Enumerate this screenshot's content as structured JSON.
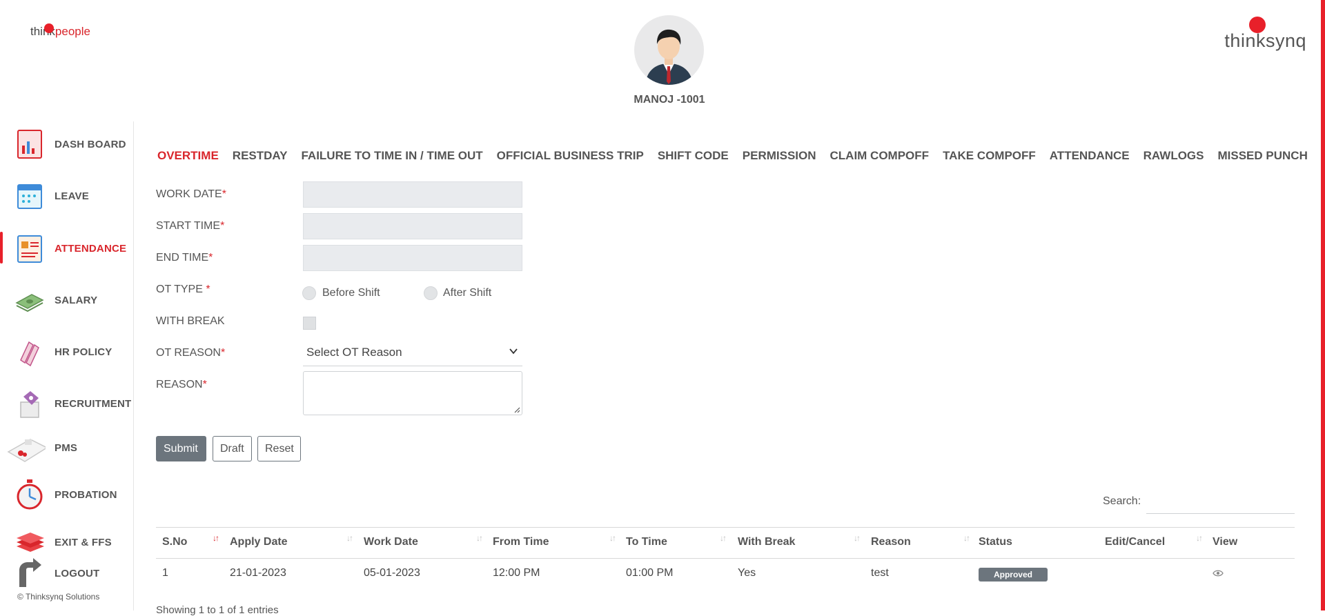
{
  "header": {
    "logo_left_prefix": "think",
    "logo_left_suffix": "people",
    "logo_right": "thinksynq",
    "user_name": "MANOJ -1001"
  },
  "sidebar": {
    "items": [
      {
        "label": "DASH BOARD",
        "icon": "dashboard-icon"
      },
      {
        "label": "LEAVE",
        "icon": "calendar-icon"
      },
      {
        "label": "ATTENDANCE",
        "icon": "attendance-icon",
        "active": true
      },
      {
        "label": "SALARY",
        "icon": "money-icon"
      },
      {
        "label": "HR POLICY",
        "icon": "policy-icon"
      },
      {
        "label": "RECRUITMENT",
        "icon": "recruitment-icon"
      },
      {
        "label": "PMS",
        "icon": "pms-icon"
      },
      {
        "label": "PROBATION",
        "icon": "stopwatch-icon"
      },
      {
        "label": "EXIT & FFS",
        "icon": "books-icon"
      },
      {
        "label": "LOGOUT",
        "icon": "logout-icon"
      }
    ],
    "copyright": "© Thinksynq Solutions"
  },
  "tabs": [
    "OVERTIME",
    "RESTDAY",
    "FAILURE TO TIME IN / TIME OUT",
    "OFFICIAL BUSINESS TRIP",
    "SHIFT CODE",
    "PERMISSION",
    "CLAIM COMPOFF",
    "TAKE COMPOFF",
    "ATTENDANCE",
    "RAWLOGS",
    "MISSED PUNCH"
  ],
  "form": {
    "work_date_label": "WORK DATE",
    "start_time_label": "START TIME",
    "end_time_label": "END TIME",
    "ot_type_label": "OT TYPE ",
    "ot_type_before": "Before Shift",
    "ot_type_after": "After Shift",
    "with_break_label": "WITH BREAK",
    "ot_reason_label": "OT REASON",
    "ot_reason_selected": "Select OT Reason",
    "reason_label": "REASON",
    "required_mark": "*",
    "submit": "Submit",
    "draft": "Draft",
    "reset": "Reset"
  },
  "table": {
    "search_label": "Search:",
    "columns": [
      "S.No",
      "Apply Date",
      "Work Date",
      "From Time",
      "To Time",
      "With Break",
      "Reason",
      "Status",
      "Edit/Cancel",
      "View"
    ],
    "rows": [
      [
        "1",
        "21-01-2023",
        "05-01-2023",
        "12:00 PM",
        "01:00 PM",
        "Yes",
        "test",
        "Approved",
        "",
        ""
      ]
    ],
    "info": "Showing 1 to 1 of 1 entries"
  },
  "colors": {
    "accent": "#e8202a",
    "muted_button": "#6c757d"
  }
}
